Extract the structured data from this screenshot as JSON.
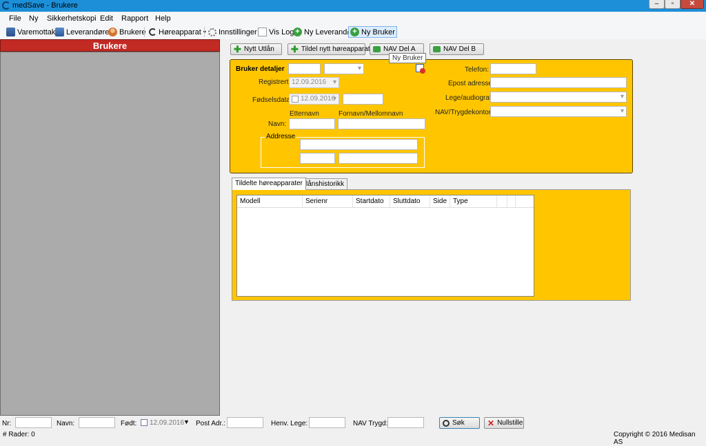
{
  "window": {
    "title": "medSave - Brukere"
  },
  "menu": [
    "File",
    "Ny",
    "Sikkerhetskopi",
    "Edit",
    "Rapport",
    "Help"
  ],
  "toolbar": {
    "varemottak": "Varemottak",
    "leverandorer": "Leverandører",
    "brukere": "Brukere",
    "horeapparat": "Høreapparat",
    "innstillinger": "Innstillinger",
    "vislog": "Vis Log",
    "ny_leverandor": "Ny Leverandør",
    "ny_bruker": "Ny Bruker"
  },
  "left_panel": {
    "title": "Brukere"
  },
  "actions": {
    "nytt_utlan": "Nytt Utlån",
    "tildel": "Tildel nytt høreapparat",
    "nav_a": "NAV Del A",
    "nav_b": "NAV Del B"
  },
  "tooltip": "Ny Bruker",
  "details": {
    "heading": "Bruker detaljer",
    "registrert_label": "Registrert:",
    "registrert_value": "12.09.2016",
    "fodsel_label": "Fødselsdata:",
    "fodsel_value": "12.09.2016",
    "etternavn_label": "Etternavn",
    "fornavn_label": "Fornavn/Mellomnavn",
    "navn_label": "Navn:",
    "adresse_label": "Addresse",
    "telefon_label": "Telefon:",
    "epost_label": "Epost adresse:",
    "lege_label": "Lege/audiograf:",
    "nav_label": "NAV/Trygdekontor:"
  },
  "tabs": [
    "Tildelte høreapparater",
    "Utlånshistorikk"
  ],
  "grid_columns": [
    "Modell",
    "Serienr",
    "Startdato",
    "Sluttdato",
    "Side",
    "Type"
  ],
  "filter": {
    "nr": "Nr:",
    "navn": "Navn:",
    "fodt": "Født:",
    "fodt_value": "12.09.2016",
    "post": "Post Adr.:",
    "henv": "Henv. Lege:",
    "nav": "NAV Trygd:",
    "sok": "Søk",
    "nullstille": "Nullstille"
  },
  "status": {
    "rows": "# Rader: 0",
    "copyright": "Copyright © 2016 Medisan AS"
  }
}
